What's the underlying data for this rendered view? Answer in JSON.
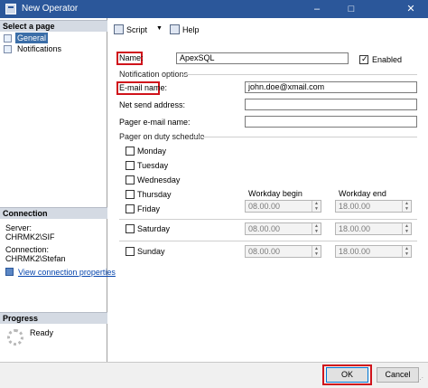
{
  "window": {
    "title": "New Operator",
    "minimize_glyph": "‒",
    "maximize_glyph": "□",
    "close_glyph": "✕"
  },
  "left_panel": {
    "select_page_header": "Select a page",
    "pages": [
      {
        "label": "General",
        "selected": true
      },
      {
        "label": "Notifications",
        "selected": false
      }
    ],
    "connection_header": "Connection",
    "server_label": "Server:",
    "server_value": "CHRMK2\\SIF",
    "connection_label": "Connection:",
    "connection_value": "CHRMK2\\Stefan",
    "view_connection_link": "View connection properties",
    "progress_header": "Progress",
    "progress_status": "Ready"
  },
  "toolbar": {
    "script_label": "Script",
    "script_dropdown_glyph": "▼",
    "help_label": "Help"
  },
  "form": {
    "name_label": "Name:",
    "name_value": "ApexSQL",
    "enabled_label": "Enabled",
    "enabled_checked": true,
    "notification_options_label": "Notification options",
    "email_label": "E-mail name:",
    "email_value": "john.doe@xmail.com",
    "net_send_label": "Net send address:",
    "net_send_value": "",
    "pager_email_label": "Pager e-mail name:",
    "pager_email_value": "",
    "pager_schedule_label": "Pager on duty schedule",
    "workday_begin_label": "Workday begin",
    "workday_end_label": "Workday end",
    "days": [
      "Monday",
      "Tuesday",
      "Wednesday",
      "Thursday",
      "Friday"
    ],
    "saturday_label": "Saturday",
    "sunday_label": "Sunday",
    "friday_begin": "08.00.00",
    "friday_end": "18.00.00",
    "saturday_begin": "08.00.00",
    "saturday_end": "18.00.00",
    "sunday_begin": "08.00.00",
    "sunday_end": "18.00.00",
    "spin_up_glyph": "▲",
    "spin_down_glyph": "▼"
  },
  "buttons": {
    "ok_label": "OK",
    "cancel_label": "Cancel"
  },
  "colors": {
    "titlebar": "#2b579a",
    "highlight": "#d0131b",
    "section_header": "#d4dae3",
    "link": "#0645ad"
  }
}
